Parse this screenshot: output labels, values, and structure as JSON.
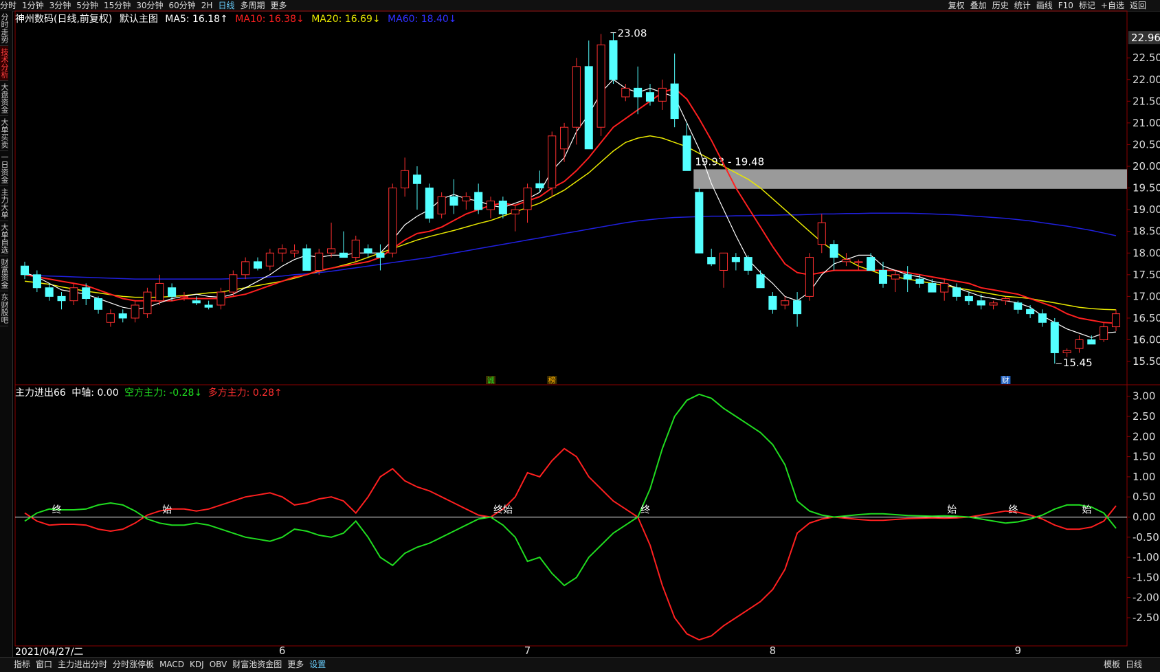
{
  "toolbar": {
    "periods": [
      "分时",
      "1分钟",
      "3分钟",
      "5分钟",
      "15分钟",
      "30分钟",
      "60分钟",
      "2H",
      "日线",
      "多周期",
      "更多"
    ],
    "active": "日线",
    "right": [
      "复权",
      "叠加",
      "历史",
      "统计",
      "画线",
      "F10",
      "标记",
      "+自选",
      "返回"
    ]
  },
  "sidenav": [
    "分时走势",
    "技术分析",
    "大盘资金",
    "大单买卖",
    "一日资金",
    "主力大单",
    "大单自选",
    "财富资金",
    "东财股吧"
  ],
  "main_legend": {
    "stock": "神州数码(日线,前复权)",
    "indicator": "默认主图",
    "ma5": "MA5: 16.18↑",
    "ma10": "MA10: 16.38↓",
    "ma20": "MA20: 16.69↓",
    "ma60": "MA60: 18.40↓"
  },
  "sub_legend": {
    "name": "主力进出66",
    "axis": "中轴: 0.00",
    "short": "空方主力: -0.28↓",
    "long": "多方主力: 0.28↑"
  },
  "colors": {
    "up": "#ff3030",
    "down": "#54ffff",
    "ma5": "#ffffff",
    "ma10": "#ff2020",
    "ma20": "#e8e800",
    "ma60": "#2020e0",
    "green": "#20dd20",
    "red": "#ff2020"
  },
  "bottom": {
    "date": "2021/04/27/二",
    "tabs": [
      "指标",
      "窗口",
      "主力进出分时",
      "分时涨停板",
      "MACD",
      "KDJ",
      "OBV",
      "财富池资金图",
      "更多",
      "设置"
    ],
    "active": "设置",
    "right": [
      "模板",
      "日线"
    ]
  },
  "chart_data": [
    {
      "type": "candlestick",
      "ylim": [
        15.2,
        23.2
      ],
      "yticks": [
        "22.50",
        "22.00",
        "21.50",
        "21.00",
        "20.50",
        "20.00",
        "19.50",
        "19.00",
        "18.50",
        "18.00",
        "17.50",
        "17.00",
        "16.50",
        "16.00",
        "15.50"
      ],
      "current_price": "22.96",
      "xlabels": [
        "6",
        "7",
        "8",
        "9"
      ],
      "xlabel_index": [
        21,
        41,
        61,
        81
      ],
      "annotations": {
        "high": "23.08",
        "low": "15.45",
        "range": "19.93 - 19.48"
      },
      "markers": [
        {
          "text": "诚",
          "i": 38
        },
        {
          "text": "榜",
          "i": 43
        },
        {
          "text": "财",
          "i": 80
        }
      ],
      "ohlc": [
        [
          17.7,
          17.8,
          17.4,
          17.5
        ],
        [
          17.5,
          17.6,
          17.1,
          17.2
        ],
        [
          17.2,
          17.3,
          16.9,
          17.0
        ],
        [
          17.0,
          17.1,
          16.7,
          16.9
        ],
        [
          16.9,
          17.3,
          16.8,
          17.2
        ],
        [
          17.2,
          17.3,
          16.8,
          16.95
        ],
        [
          16.95,
          17.0,
          16.6,
          16.7
        ],
        [
          16.4,
          16.7,
          16.3,
          16.6
        ],
        [
          16.6,
          16.7,
          16.4,
          16.5
        ],
        [
          16.5,
          16.9,
          16.4,
          16.8
        ],
        [
          16.6,
          17.2,
          16.5,
          17.1
        ],
        [
          16.9,
          17.5,
          16.8,
          17.3
        ],
        [
          17.2,
          17.3,
          16.9,
          17.0
        ],
        [
          17.0,
          17.1,
          16.9,
          17.0
        ],
        [
          16.9,
          17.0,
          16.8,
          16.85
        ],
        [
          16.8,
          16.9,
          16.7,
          16.75
        ],
        [
          16.8,
          17.2,
          16.7,
          17.1
        ],
        [
          17.1,
          17.6,
          17.0,
          17.5
        ],
        [
          17.5,
          17.9,
          17.4,
          17.8
        ],
        [
          17.8,
          17.9,
          17.6,
          17.65
        ],
        [
          17.7,
          18.1,
          17.6,
          18.0
        ],
        [
          18.0,
          18.2,
          17.8,
          18.1
        ],
        [
          18.0,
          18.2,
          17.9,
          18.05
        ],
        [
          18.1,
          18.2,
          17.6,
          17.6
        ],
        [
          17.6,
          18.1,
          17.5,
          18.0
        ],
        [
          18.0,
          18.7,
          17.9,
          18.1
        ],
        [
          18.0,
          18.5,
          17.9,
          17.9
        ],
        [
          17.9,
          18.4,
          17.8,
          18.3
        ],
        [
          18.1,
          18.2,
          17.9,
          18.0
        ],
        [
          18.0,
          18.2,
          17.6,
          17.9
        ],
        [
          18.0,
          19.6,
          17.9,
          19.5
        ],
        [
          19.5,
          20.2,
          19.3,
          19.9
        ],
        [
          19.8,
          20.0,
          19.0,
          19.6
        ],
        [
          19.5,
          19.6,
          18.7,
          18.8
        ],
        [
          18.9,
          19.4,
          18.8,
          19.3
        ],
        [
          19.3,
          19.7,
          18.9,
          19.1
        ],
        [
          19.2,
          19.4,
          19.0,
          19.3
        ],
        [
          19.4,
          19.6,
          18.9,
          19.0
        ],
        [
          19.0,
          19.3,
          18.8,
          19.2
        ],
        [
          19.2,
          19.3,
          18.8,
          18.9
        ],
        [
          18.9,
          19.1,
          18.5,
          19.0
        ],
        [
          19.0,
          19.6,
          18.7,
          19.5
        ],
        [
          19.6,
          19.9,
          19.4,
          19.5
        ],
        [
          19.5,
          20.8,
          19.3,
          20.7
        ],
        [
          20.4,
          21.0,
          20.1,
          20.9
        ],
        [
          20.9,
          22.5,
          20.5,
          22.3
        ],
        [
          22.3,
          22.9,
          21.0,
          20.4
        ],
        [
          20.9,
          23.05,
          20.7,
          22.8
        ],
        [
          22.9,
          23.08,
          21.9,
          22.0
        ],
        [
          21.6,
          21.9,
          21.5,
          21.8
        ],
        [
          21.8,
          22.3,
          21.2,
          21.6
        ],
        [
          21.7,
          21.9,
          21.4,
          21.5
        ],
        [
          21.5,
          22.0,
          21.3,
          21.8
        ],
        [
          21.9,
          22.6,
          20.9,
          21.1
        ],
        [
          20.7,
          21.0,
          19.9,
          19.9
        ],
        [
          19.4,
          19.5,
          18.0,
          18.0
        ],
        [
          17.9,
          18.1,
          17.7,
          17.75
        ],
        [
          17.6,
          18.0,
          17.2,
          18.0
        ],
        [
          17.9,
          18.0,
          17.6,
          17.8
        ],
        [
          17.9,
          17.95,
          17.5,
          17.6
        ],
        [
          17.5,
          17.6,
          17.2,
          17.2
        ],
        [
          17.0,
          17.1,
          16.6,
          16.7
        ],
        [
          16.8,
          17.0,
          16.7,
          16.9
        ],
        [
          16.9,
          17.1,
          16.3,
          16.6
        ],
        [
          17.0,
          18.0,
          16.9,
          17.9
        ],
        [
          18.2,
          18.9,
          18.0,
          18.7
        ],
        [
          18.2,
          18.3,
          17.6,
          17.9
        ],
        [
          17.8,
          18.0,
          17.7,
          17.85
        ],
        [
          17.8,
          17.85,
          17.6,
          17.8
        ],
        [
          17.9,
          18.0,
          17.6,
          17.6
        ],
        [
          17.6,
          17.8,
          17.2,
          17.3
        ],
        [
          17.4,
          17.6,
          17.1,
          17.5
        ],
        [
          17.5,
          17.7,
          17.1,
          17.4
        ],
        [
          17.4,
          17.5,
          17.2,
          17.3
        ],
        [
          17.3,
          17.4,
          17.1,
          17.1
        ],
        [
          17.1,
          17.4,
          16.9,
          17.3
        ],
        [
          17.2,
          17.3,
          16.9,
          17.0
        ],
        [
          17.0,
          17.1,
          16.8,
          16.9
        ],
        [
          16.9,
          17.05,
          16.7,
          16.8
        ],
        [
          16.8,
          16.9,
          16.7,
          16.85
        ],
        [
          16.9,
          17.0,
          16.8,
          16.95
        ],
        [
          16.85,
          16.9,
          16.6,
          16.7
        ],
        [
          16.7,
          16.8,
          16.5,
          16.6
        ],
        [
          16.6,
          16.7,
          16.3,
          16.4
        ],
        [
          16.4,
          16.5,
          15.45,
          15.7
        ],
        [
          15.7,
          15.8,
          15.6,
          15.75
        ],
        [
          15.8,
          16.1,
          15.7,
          16.0
        ],
        [
          16.0,
          16.1,
          15.9,
          15.9
        ],
        [
          16.0,
          16.4,
          15.95,
          16.3
        ],
        [
          16.3,
          16.7,
          16.2,
          16.6
        ]
      ],
      "ma5": [
        17.55,
        17.45,
        17.3,
        17.15,
        17.1,
        17.05,
        16.95,
        16.85,
        16.75,
        16.7,
        16.75,
        16.85,
        16.95,
        17.0,
        17.05,
        17.0,
        16.98,
        17.05,
        17.2,
        17.35,
        17.5,
        17.7,
        17.85,
        17.95,
        17.9,
        17.95,
        17.95,
        18.0,
        18.0,
        18.0,
        18.3,
        18.65,
        18.85,
        19.0,
        19.25,
        19.35,
        19.25,
        19.2,
        19.1,
        19.05,
        19.15,
        19.25,
        19.4,
        19.9,
        20.2,
        20.8,
        21.2,
        21.7,
        22.0,
        21.8,
        21.7,
        21.8,
        21.7,
        21.6,
        21.0,
        20.4,
        19.6,
        19.0,
        18.4,
        17.85,
        17.55,
        17.3,
        17.0,
        16.9,
        17.1,
        17.5,
        17.75,
        17.85,
        17.95,
        17.95,
        17.7,
        17.6,
        17.5,
        17.45,
        17.35,
        17.3,
        17.2,
        17.1,
        17.0,
        16.95,
        16.9,
        16.85,
        16.75,
        16.55,
        16.4,
        16.25,
        16.15,
        16.05,
        16.15,
        16.18
      ],
      "ma10": [
        17.5,
        17.45,
        17.4,
        17.35,
        17.3,
        17.25,
        17.15,
        17.05,
        16.95,
        16.9,
        16.9,
        16.9,
        16.9,
        16.95,
        16.95,
        16.95,
        16.95,
        17.0,
        17.05,
        17.15,
        17.25,
        17.35,
        17.45,
        17.5,
        17.6,
        17.65,
        17.7,
        17.75,
        17.8,
        17.9,
        18.1,
        18.3,
        18.45,
        18.5,
        18.6,
        18.75,
        18.9,
        19.0,
        19.1,
        19.15,
        19.1,
        19.2,
        19.3,
        19.5,
        19.65,
        19.9,
        20.2,
        20.55,
        20.9,
        21.1,
        21.3,
        21.5,
        21.7,
        21.8,
        21.55,
        21.1,
        20.6,
        20.05,
        19.5,
        19.05,
        18.6,
        18.15,
        17.75,
        17.55,
        17.5,
        17.55,
        17.6,
        17.6,
        17.6,
        17.6,
        17.6,
        17.6,
        17.55,
        17.5,
        17.45,
        17.4,
        17.35,
        17.3,
        17.2,
        17.15,
        17.1,
        17.05,
        16.95,
        16.85,
        16.75,
        16.6,
        16.5,
        16.45,
        16.4,
        16.38
      ],
      "ma20": [
        17.35,
        17.32,
        17.28,
        17.22,
        17.17,
        17.12,
        17.08,
        17.04,
        17.0,
        16.98,
        16.98,
        16.98,
        17.0,
        17.02,
        17.05,
        17.08,
        17.1,
        17.15,
        17.2,
        17.25,
        17.3,
        17.35,
        17.42,
        17.5,
        17.58,
        17.65,
        17.72,
        17.8,
        17.9,
        18.0,
        18.1,
        18.2,
        18.3,
        18.38,
        18.45,
        18.52,
        18.6,
        18.68,
        18.75,
        18.85,
        18.95,
        19.05,
        19.15,
        19.3,
        19.45,
        19.65,
        19.85,
        20.1,
        20.35,
        20.55,
        20.65,
        20.7,
        20.65,
        20.55,
        20.45,
        20.3,
        20.15,
        20.0,
        19.85,
        19.7,
        19.5,
        19.25,
        19.0,
        18.75,
        18.5,
        18.25,
        18.05,
        17.85,
        17.7,
        17.6,
        17.5,
        17.45,
        17.4,
        17.35,
        17.3,
        17.25,
        17.2,
        17.15,
        17.1,
        17.05,
        17.0,
        16.98,
        16.95,
        16.9,
        16.85,
        16.8,
        16.75,
        16.72,
        16.7,
        16.69
      ],
      "ma60": [
        17.5,
        17.48,
        17.47,
        17.46,
        17.45,
        17.44,
        17.43,
        17.42,
        17.41,
        17.4,
        17.4,
        17.4,
        17.4,
        17.4,
        17.4,
        17.4,
        17.4,
        17.41,
        17.42,
        17.43,
        17.45,
        17.47,
        17.5,
        17.52,
        17.55,
        17.58,
        17.62,
        17.66,
        17.7,
        17.74,
        17.78,
        17.82,
        17.86,
        17.9,
        17.95,
        18.0,
        18.05,
        18.1,
        18.15,
        18.2,
        18.25,
        18.3,
        18.35,
        18.4,
        18.45,
        18.5,
        18.55,
        18.6,
        18.65,
        18.7,
        18.74,
        18.77,
        18.8,
        18.82,
        18.83,
        18.84,
        18.85,
        18.85,
        18.86,
        18.86,
        18.87,
        18.87,
        18.88,
        18.88,
        18.89,
        18.9,
        18.9,
        18.91,
        18.91,
        18.92,
        18.92,
        18.92,
        18.92,
        18.91,
        18.9,
        18.89,
        18.88,
        18.86,
        18.84,
        18.82,
        18.8,
        18.77,
        18.74,
        18.7,
        18.66,
        18.62,
        18.57,
        18.52,
        18.46,
        18.4
      ]
    },
    {
      "type": "line",
      "ylim": [
        -3.2,
        3.2
      ],
      "yticks": [
        "3.00",
        "2.50",
        "2.00",
        "1.50",
        "1.00",
        "0.50",
        "0.00",
        "-0.50",
        "-1.00",
        "-1.50",
        "-2.00",
        "-2.50"
      ],
      "series": [
        {
          "name": "空方主力",
          "values": [
            -0.1,
            0.1,
            0.2,
            0.18,
            0.18,
            0.2,
            0.3,
            0.35,
            0.3,
            0.15,
            -0.05,
            -0.15,
            -0.2,
            -0.2,
            -0.15,
            -0.2,
            -0.3,
            -0.4,
            -0.5,
            -0.55,
            -0.6,
            -0.5,
            -0.3,
            -0.35,
            -0.45,
            -0.5,
            -0.4,
            -0.1,
            -0.5,
            -1.0,
            -1.2,
            -0.9,
            -0.75,
            -0.65,
            -0.5,
            -0.35,
            -0.2,
            -0.05,
            0.0,
            -0.2,
            -0.5,
            -1.1,
            -1.0,
            -1.4,
            -1.7,
            -1.5,
            -1.0,
            -0.7,
            -0.4,
            -0.2,
            0.0,
            0.7,
            1.7,
            2.5,
            2.9,
            3.05,
            2.95,
            2.7,
            2.5,
            2.3,
            2.1,
            1.8,
            1.3,
            0.4,
            0.15,
            0.05,
            0.0,
            0.03,
            0.06,
            0.08,
            0.08,
            0.06,
            0.04,
            0.03,
            0.02,
            0.03,
            0.02,
            0.0,
            -0.05,
            -0.1,
            -0.15,
            -0.12,
            -0.05,
            0.05,
            0.2,
            0.3,
            0.3,
            0.25,
            0.1,
            -0.28
          ]
        },
        {
          "name": "多方主力",
          "values": [
            0.1,
            -0.1,
            -0.2,
            -0.18,
            -0.18,
            -0.2,
            -0.3,
            -0.35,
            -0.3,
            -0.15,
            0.05,
            0.15,
            0.2,
            0.2,
            0.15,
            0.2,
            0.3,
            0.4,
            0.5,
            0.55,
            0.6,
            0.5,
            0.3,
            0.35,
            0.45,
            0.5,
            0.4,
            0.1,
            0.5,
            1.0,
            1.2,
            0.9,
            0.75,
            0.65,
            0.5,
            0.35,
            0.2,
            0.05,
            0.0,
            0.2,
            0.5,
            1.1,
            1.0,
            1.4,
            1.7,
            1.5,
            1.0,
            0.7,
            0.4,
            0.2,
            0.0,
            -0.7,
            -1.7,
            -2.5,
            -2.9,
            -3.05,
            -2.95,
            -2.7,
            -2.5,
            -2.3,
            -2.1,
            -1.8,
            -1.3,
            -0.4,
            -0.15,
            -0.05,
            0.0,
            -0.03,
            -0.06,
            -0.08,
            -0.08,
            -0.06,
            -0.04,
            -0.03,
            -0.02,
            -0.03,
            -0.02,
            0.0,
            0.05,
            0.1,
            0.15,
            0.12,
            0.05,
            -0.05,
            -0.2,
            -0.3,
            -0.3,
            -0.25,
            -0.1,
            0.28
          ]
        }
      ],
      "markers": [
        {
          "text": "终",
          "i": 2
        },
        {
          "text": "始",
          "i": 11
        },
        {
          "text": "终始",
          "i": 38
        },
        {
          "text": "终",
          "i": 50
        },
        {
          "text": "始",
          "i": 75
        },
        {
          "text": "终",
          "i": 80
        },
        {
          "text": "始",
          "i": 86
        }
      ]
    }
  ]
}
